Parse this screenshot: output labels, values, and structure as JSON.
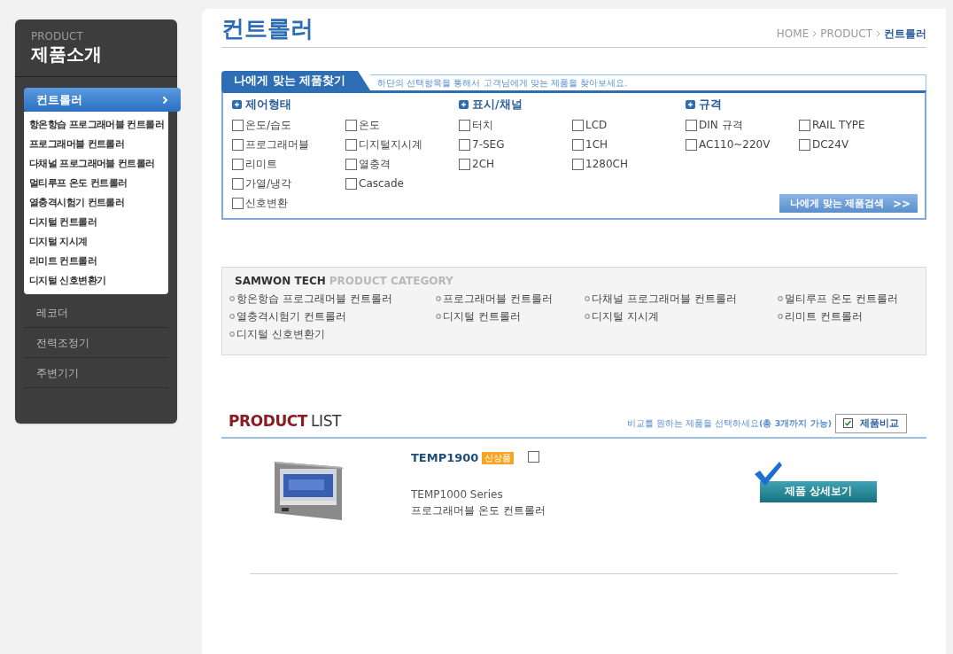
{
  "sidebar": {
    "eyebrow": "PRODUCT",
    "title": "제품소개",
    "items": [
      {
        "label": "컨트롤러",
        "selected": true,
        "children": [
          {
            "label": "항온항습 프로그래머블 컨트롤러"
          },
          {
            "label": "프로그래머블 컨트롤러"
          },
          {
            "label": "다채널 프로그래머블 컨트롤러"
          },
          {
            "label": "멀티루프 온도 컨트롤러"
          },
          {
            "label": "열충격시험기 컨트롤러"
          },
          {
            "label": "디지털 컨트롤러"
          },
          {
            "label": "디지털 지시계"
          },
          {
            "label": "리미트 컨트롤러"
          },
          {
            "label": "디지털 신호변환기"
          }
        ]
      },
      {
        "label": "레코더",
        "selected": false
      },
      {
        "label": "전력조정기",
        "selected": false
      },
      {
        "label": "주변기기",
        "selected": false
      }
    ]
  },
  "page": {
    "title": "컨트롤러",
    "breadcrumb": [
      {
        "label": "HOME",
        "current": false
      },
      {
        "label": "PRODUCT",
        "current": false
      },
      {
        "label": "컨트롤러",
        "current": true
      }
    ]
  },
  "finder": {
    "tab": "나에게 맞는 제품찾기",
    "hint": "하단의 선택항목을 통해서 고객님에게 맞는 제품을 찾아보세요.",
    "groups": [
      {
        "title": "제어형태",
        "options": [
          {
            "label": "온도/습도",
            "checked": false
          },
          {
            "label": "온도",
            "checked": false
          },
          {
            "label": "프로그래머블",
            "checked": false
          },
          {
            "label": "디지털지시계",
            "checked": false
          },
          {
            "label": "리미트",
            "checked": false
          },
          {
            "label": "열충격",
            "checked": false
          },
          {
            "label": "가열/냉각",
            "checked": false
          },
          {
            "label": "Cascade",
            "checked": false
          },
          {
            "label": "신호변환",
            "checked": false
          }
        ]
      },
      {
        "title": "표시/채널",
        "options": [
          {
            "label": "터치",
            "checked": false
          },
          {
            "label": "LCD",
            "checked": false
          },
          {
            "label": "7-SEG",
            "checked": false
          },
          {
            "label": "1CH",
            "checked": false
          },
          {
            "label": "2CH",
            "checked": false
          },
          {
            "label": "1280CH",
            "checked": false
          }
        ]
      },
      {
        "title": "규격",
        "options": [
          {
            "label": "DIN 규격",
            "checked": false
          },
          {
            "label": "RAIL TYPE",
            "checked": false
          },
          {
            "label": "AC110~220V",
            "checked": false
          },
          {
            "label": "DC24V",
            "checked": false
          }
        ]
      }
    ],
    "search_button": "나에게 맞는 제품검색",
    "search_arrow": ">>"
  },
  "category": {
    "brand": "SAMWON TECH",
    "title": "PRODUCT CATEGORY",
    "links": [
      "항온항습 프로그래머블 컨트롤러",
      "프로그래머블 컨트롤러",
      "다채널 프로그래머블 컨트롤러",
      "멀티루프 온도 컨트롤러",
      "열충격시험기 컨트롤러",
      "디지털 컨트롤러",
      "디지털 지시계",
      "리미트 컨트롤러",
      "디지털 신호변환기"
    ]
  },
  "product_list": {
    "title_bold": "PRODUCT",
    "title_rest": "LIST",
    "compare_hint": "비교를 원하는 제품을 선택하세요**(총 3개까지 가능)**",
    "compare_button": "제품비교",
    "products": [
      {
        "name": "TEMP1900",
        "badge": "신상품",
        "checked": false,
        "series": "TEMP1000 Series",
        "description": "프로그래머블 온도 컨트롤러",
        "detail_button": "제품 상세보기"
      }
    ]
  }
}
